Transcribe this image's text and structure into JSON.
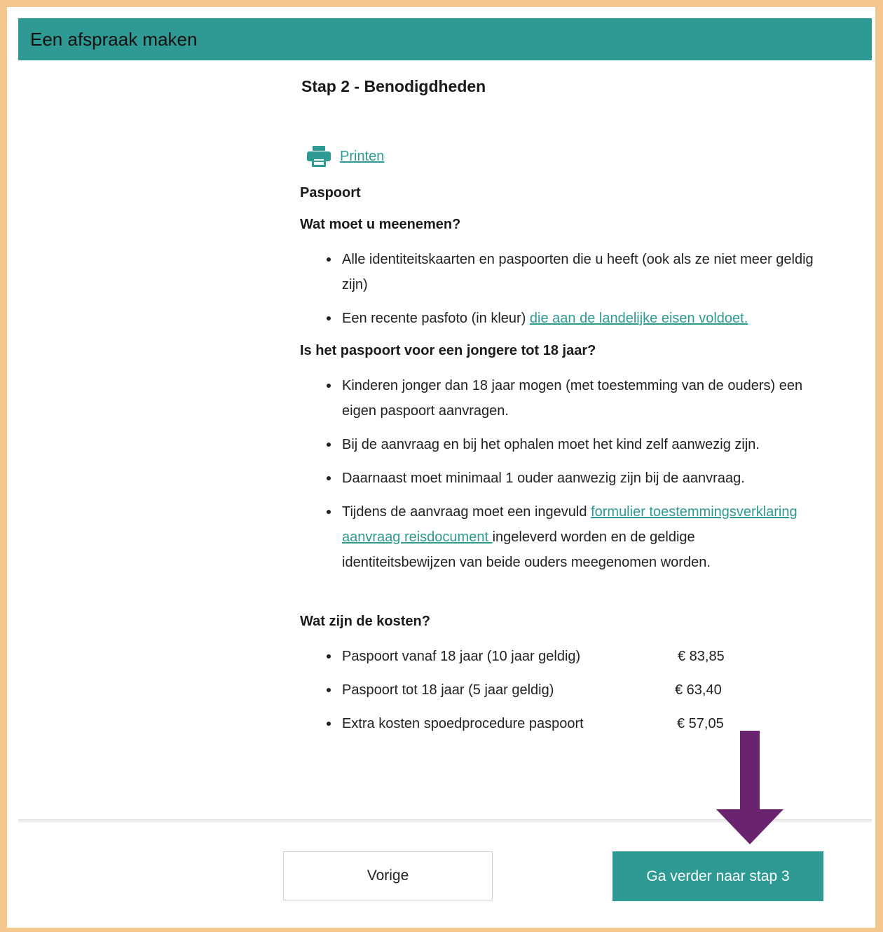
{
  "header": {
    "title": "Een afspraak maken"
  },
  "step": {
    "title": "Stap 2 - Benodigdheden"
  },
  "print": {
    "label": "Printen",
    "icon": "printer-icon"
  },
  "colors": {
    "accent": "#2e9a93",
    "frame": "#f5c68e",
    "arrow": "#6a236e"
  },
  "content": {
    "product": "Paspoort",
    "bring": {
      "heading": "Wat moet u meenemen?",
      "items": [
        {
          "text": "Alle identiteitskaarten en paspoorten die u heeft (ook als ze niet meer geldig zijn)"
        },
        {
          "text": "Een recente pasfoto (in kleur) ",
          "link": "die aan de landelijke eisen voldoet."
        }
      ]
    },
    "minors": {
      "heading": "Is het paspoort voor een jongere tot 18 jaar?",
      "items": [
        {
          "text": "Kinderen jonger dan 18 jaar mogen (met toestemming van de ouders) een eigen paspoort aanvragen."
        },
        {
          "text": "Bij de aanvraag en bij het ophalen moet het kind zelf aanwezig zijn."
        },
        {
          "text": "Daarnaast moet minimaal 1 ouder aanwezig zijn bij de aanvraag."
        },
        {
          "text_before": "Tijdens de aanvraag moet een ingevuld ",
          "link": "formulier toestemmingsverklaring aanvraag reisdocument ",
          "text_after": "ingeleverd worden en de geldige identiteitsbewijzen van beide ouders meegenomen worden."
        }
      ]
    },
    "costs": {
      "heading": "Wat zijn de kosten?",
      "items": [
        {
          "label": "Paspoort vanaf 18 jaar (10 jaar geldig)",
          "price": "€ 83,85"
        },
        {
          "label": "Paspoort tot 18 jaar (5 jaar geldig)",
          "price": "€ 63,40"
        },
        {
          "label": "Extra kosten spoedprocedure paspoort",
          "price": "€ 57,05"
        }
      ]
    }
  },
  "footer": {
    "prev_label": "Vorige",
    "next_label": "Ga verder naar stap 3"
  },
  "annotation": {
    "arrow_icon": "arrow-down-icon"
  }
}
